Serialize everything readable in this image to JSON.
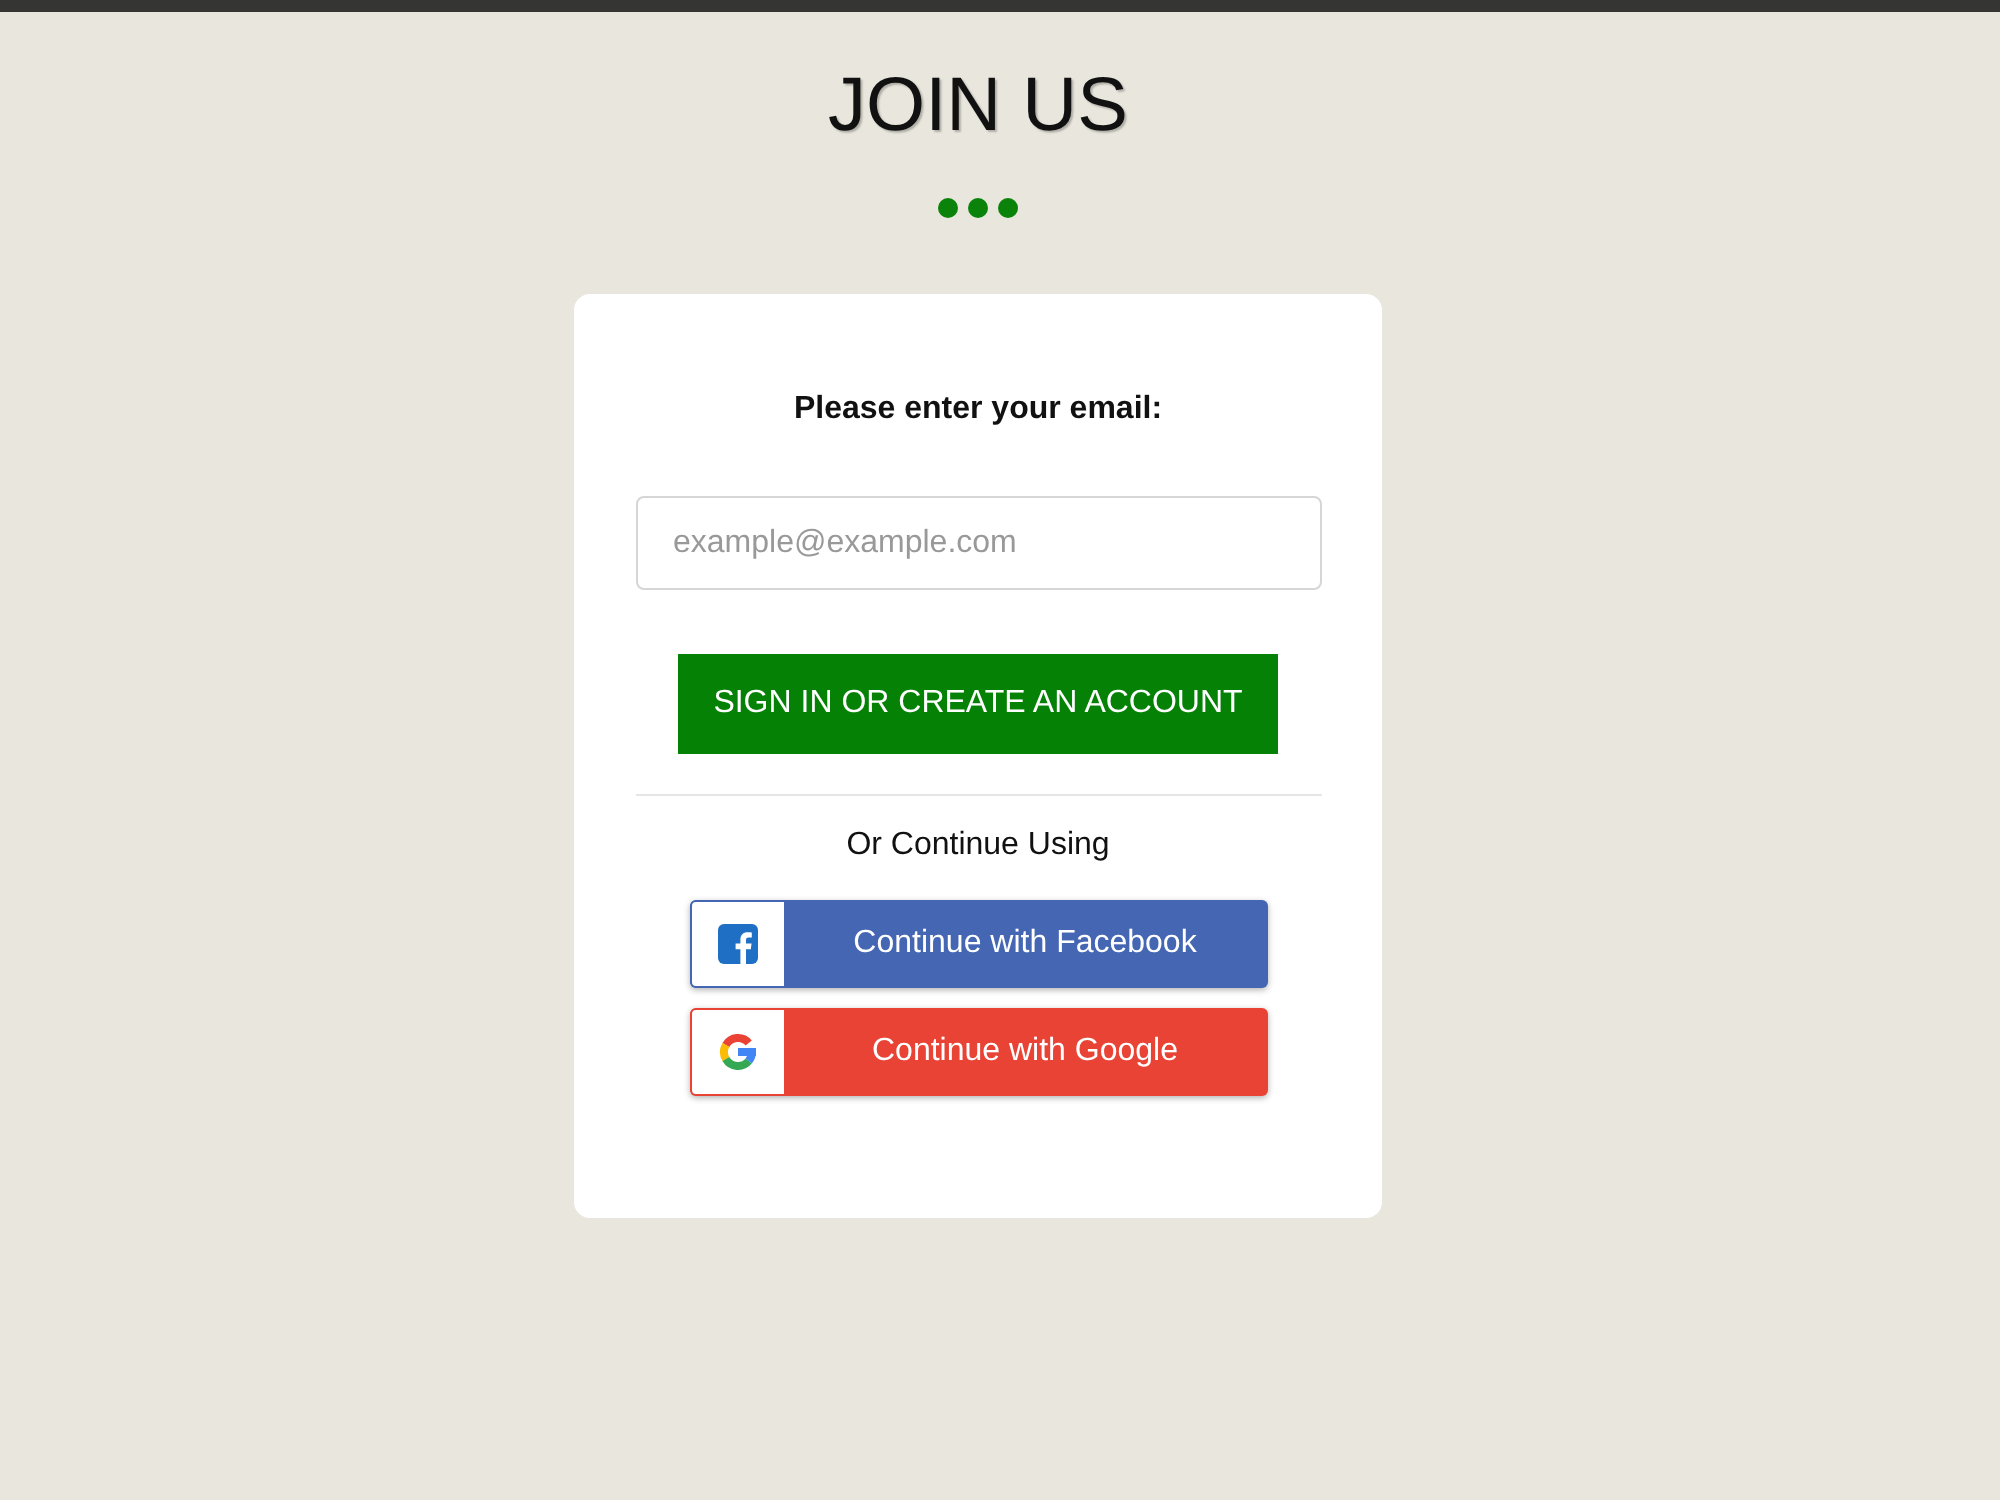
{
  "header": {
    "title": "JOIN US"
  },
  "form": {
    "prompt": "Please enter your email:",
    "email_field": {
      "placeholder": "example@example.com"
    },
    "submit_button": "SIGN IN OR CREATE AN ACCOUNT",
    "divider_text": "Or Continue Using",
    "social_buttons": [
      {
        "kind": "facebook",
        "label": "Continue with Facebook"
      },
      {
        "kind": "google",
        "label": "Continue with Google"
      }
    ]
  }
}
